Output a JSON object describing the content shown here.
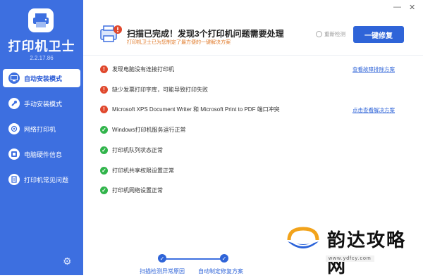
{
  "app": {
    "name": "打印机卫士",
    "version": "2.2.17.86"
  },
  "sidebar": {
    "items": [
      {
        "label": "自动安装模式",
        "active": true
      },
      {
        "label": "手动安装模式"
      },
      {
        "label": "网络打印机"
      },
      {
        "label": "电脑硬件信息"
      },
      {
        "label": "打印机常见问题"
      }
    ]
  },
  "window": {
    "minimize": "—",
    "close": "✕"
  },
  "header": {
    "title": "扫描已完成！发现3个打印机问题需要处理",
    "subtitle": "打印机卫士已为您制定了最方便的一键解决方案",
    "rescan": "重新检测",
    "fix_button": "一键修复"
  },
  "issues": [
    {
      "text": "发现电脑没有连接打印机",
      "status": "error",
      "link": "查看故障排除方案"
    },
    {
      "text": "缺少发票打印字库，可能导致打印失败",
      "status": "error",
      "link": ""
    },
    {
      "text": "Microsoft XPS Document Writer 和 Microsoft Print to PDF 端口冲突",
      "status": "error",
      "link": "点击查看解决方案"
    },
    {
      "text": "Windows打印机服务运行正常",
      "status": "ok",
      "link": ""
    },
    {
      "text": "打印机队列状态正常",
      "status": "ok",
      "link": ""
    },
    {
      "text": "打印机共享权限设置正常",
      "status": "ok",
      "link": ""
    },
    {
      "text": "打印机网络设置正常",
      "status": "ok",
      "link": ""
    }
  ],
  "steps": [
    {
      "label": "扫描检测异常原因"
    },
    {
      "label": "自动制定修复方案"
    }
  ],
  "watermark": {
    "text": "韵达攻略网",
    "url": "www.ydfcy.com"
  },
  "colors": {
    "primary": "#3d6fe0",
    "error": "#e0482d",
    "ok": "#31b44b",
    "accent": "#e07a2a"
  }
}
